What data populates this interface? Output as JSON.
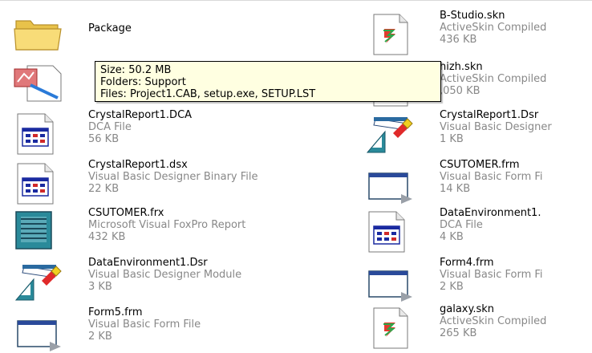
{
  "files": [
    {
      "name": "Package",
      "type": "",
      "size": "",
      "icon": "folder-icon"
    },
    {
      "name": "B-Studio.skn",
      "type": "ActiveSkin Compiled",
      "size": "436 KB",
      "icon": "activeskin-file-icon"
    },
    {
      "name": "",
      "type": "",
      "size": "",
      "icon": "setup-package-icon"
    },
    {
      "name": "hizh.skn",
      "type": "ActiveSkin Compiled",
      "size": ",050 KB",
      "icon": "activeskin-file-icon"
    },
    {
      "name": "CrystalReport1.DCA",
      "type": "DCA File",
      "size": "56 KB",
      "icon": "dca-file-icon"
    },
    {
      "name": "CrystalReport1.Dsr",
      "type": "Visual Basic Designer",
      "size": "1 KB",
      "icon": "vb-designer-icon"
    },
    {
      "name": "CrystalReport1.dsx",
      "type": "Visual Basic Designer Binary File",
      "size": "22 KB",
      "icon": "dca-file-icon"
    },
    {
      "name": "CSUTOMER.frm",
      "type": "Visual Basic Form Fi",
      "size": "14 KB",
      "icon": "vb-form-icon"
    },
    {
      "name": "CSUTOMER.frx",
      "type": "Microsoft Visual FoxPro Report",
      "size": "432 KB",
      "icon": "foxpro-report-icon"
    },
    {
      "name": "DataEnvironment1.",
      "type": "DCA File",
      "size": "4 KB",
      "icon": "dca-file-icon"
    },
    {
      "name": "DataEnvironment1.Dsr",
      "type": "Visual Basic Designer Module",
      "size": "3 KB",
      "icon": "vb-designer-icon"
    },
    {
      "name": "Form4.frm",
      "type": "Visual Basic Form Fi",
      "size": "2 KB",
      "icon": "vb-form-icon"
    },
    {
      "name": "Form5.frm",
      "type": "Visual Basic Form File",
      "size": "2 KB",
      "icon": "vb-form-icon"
    },
    {
      "name": "galaxy.skn",
      "type": "ActiveSkin Compiled",
      "size": "265 KB",
      "icon": "activeskin-file-icon"
    }
  ],
  "tooltip": {
    "line1": "Size: 50.2 MB",
    "line2": "Folders: Support",
    "line3": "Files: Project1.CAB, setup.exe, SETUP.LST"
  },
  "colors": {
    "tooltip_bg": "#ffffe1",
    "secondary_text": "#888888",
    "folder_yellow": "#f5d76e"
  }
}
